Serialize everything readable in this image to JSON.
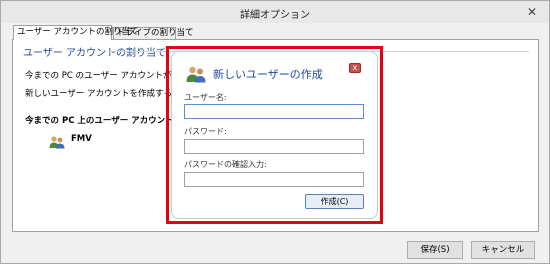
{
  "window": {
    "title": "詳細オプション",
    "close_glyph": "✕"
  },
  "tabs": [
    {
      "label": "ユーザー アカウントの割り当て"
    },
    {
      "label": "ドライブの割り当て"
    }
  ],
  "panel": {
    "section_title": "ユーザー アカウントの割り当て",
    "description_line1": "今までの PC のユーザー アカウントが、新しい",
    "description_line2": "新しいユーザー アカウントを作成するには、次の",
    "accounts_heading": "今までの PC 上のユーザー アカウント:",
    "accounts": [
      {
        "name": "FMV",
        "icon": "users-icon"
      }
    ]
  },
  "dialog": {
    "title": "新しいユーザーの作成",
    "icon": "users-icon",
    "close_glyph": "x",
    "username_label": "ユーザー名:",
    "username_value": "",
    "password_label": "パスワード:",
    "password_value": "",
    "confirm_label": "パスワードの確認入力:",
    "confirm_value": "",
    "create_button": "作成(C)"
  },
  "footer": {
    "save_button": "保存(S)",
    "cancel_button": "キャンセル"
  },
  "colors": {
    "highlight": "#e60012",
    "accent": "#1e4a9a"
  }
}
